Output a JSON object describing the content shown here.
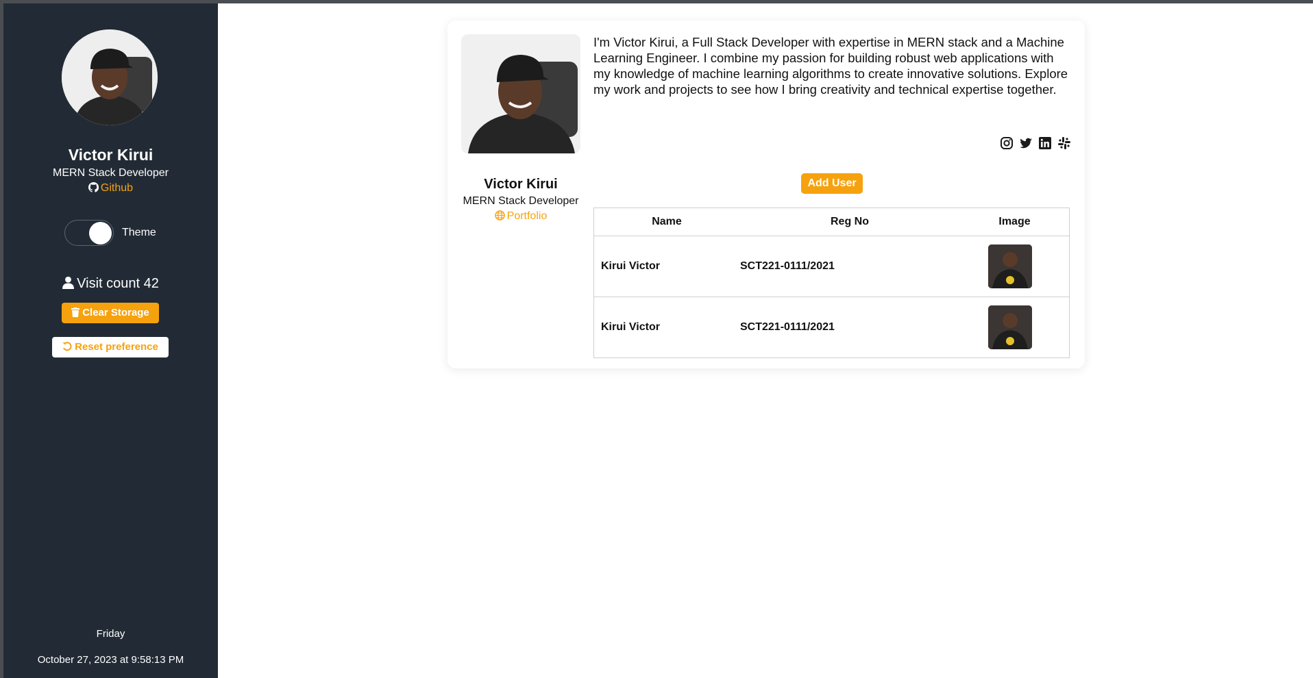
{
  "sidebar": {
    "name": "Victor Kirui",
    "role": "MERN Stack Developer",
    "github_label": "Github",
    "theme_label": "Theme",
    "visit_label": "Visit count 42",
    "clear_label": "Clear Storage",
    "reset_label": "Reset preference",
    "day": "Friday",
    "datetime": "October 27, 2023 at 9:58:13 PM"
  },
  "card": {
    "bio": "I'm Victor Kirui, a Full Stack Developer with expertise in MERN stack and a Machine Learning Engineer. I combine my passion for building robust web applications with my knowledge of machine learning algorithms to create innovative solutions. Explore my work and projects to see how I bring creativity and technical expertise together.",
    "name": "Victor Kirui",
    "role": "MERN Stack Developer",
    "portfolio_label": "Portfolio",
    "socials": [
      "instagram-icon",
      "twitter-icon",
      "linkedin-icon",
      "slack-icon"
    ],
    "add_user_label": "Add User"
  },
  "table": {
    "headers": [
      "Name",
      "Reg No",
      "Image"
    ],
    "rows": [
      {
        "name": "Kirui Victor",
        "reg_no": "SCT221-0111/2021"
      },
      {
        "name": "Kirui Victor",
        "reg_no": "SCT221-0111/2021"
      }
    ]
  },
  "colors": {
    "accent": "#f6a20e",
    "sidebar_bg": "#222b35"
  }
}
